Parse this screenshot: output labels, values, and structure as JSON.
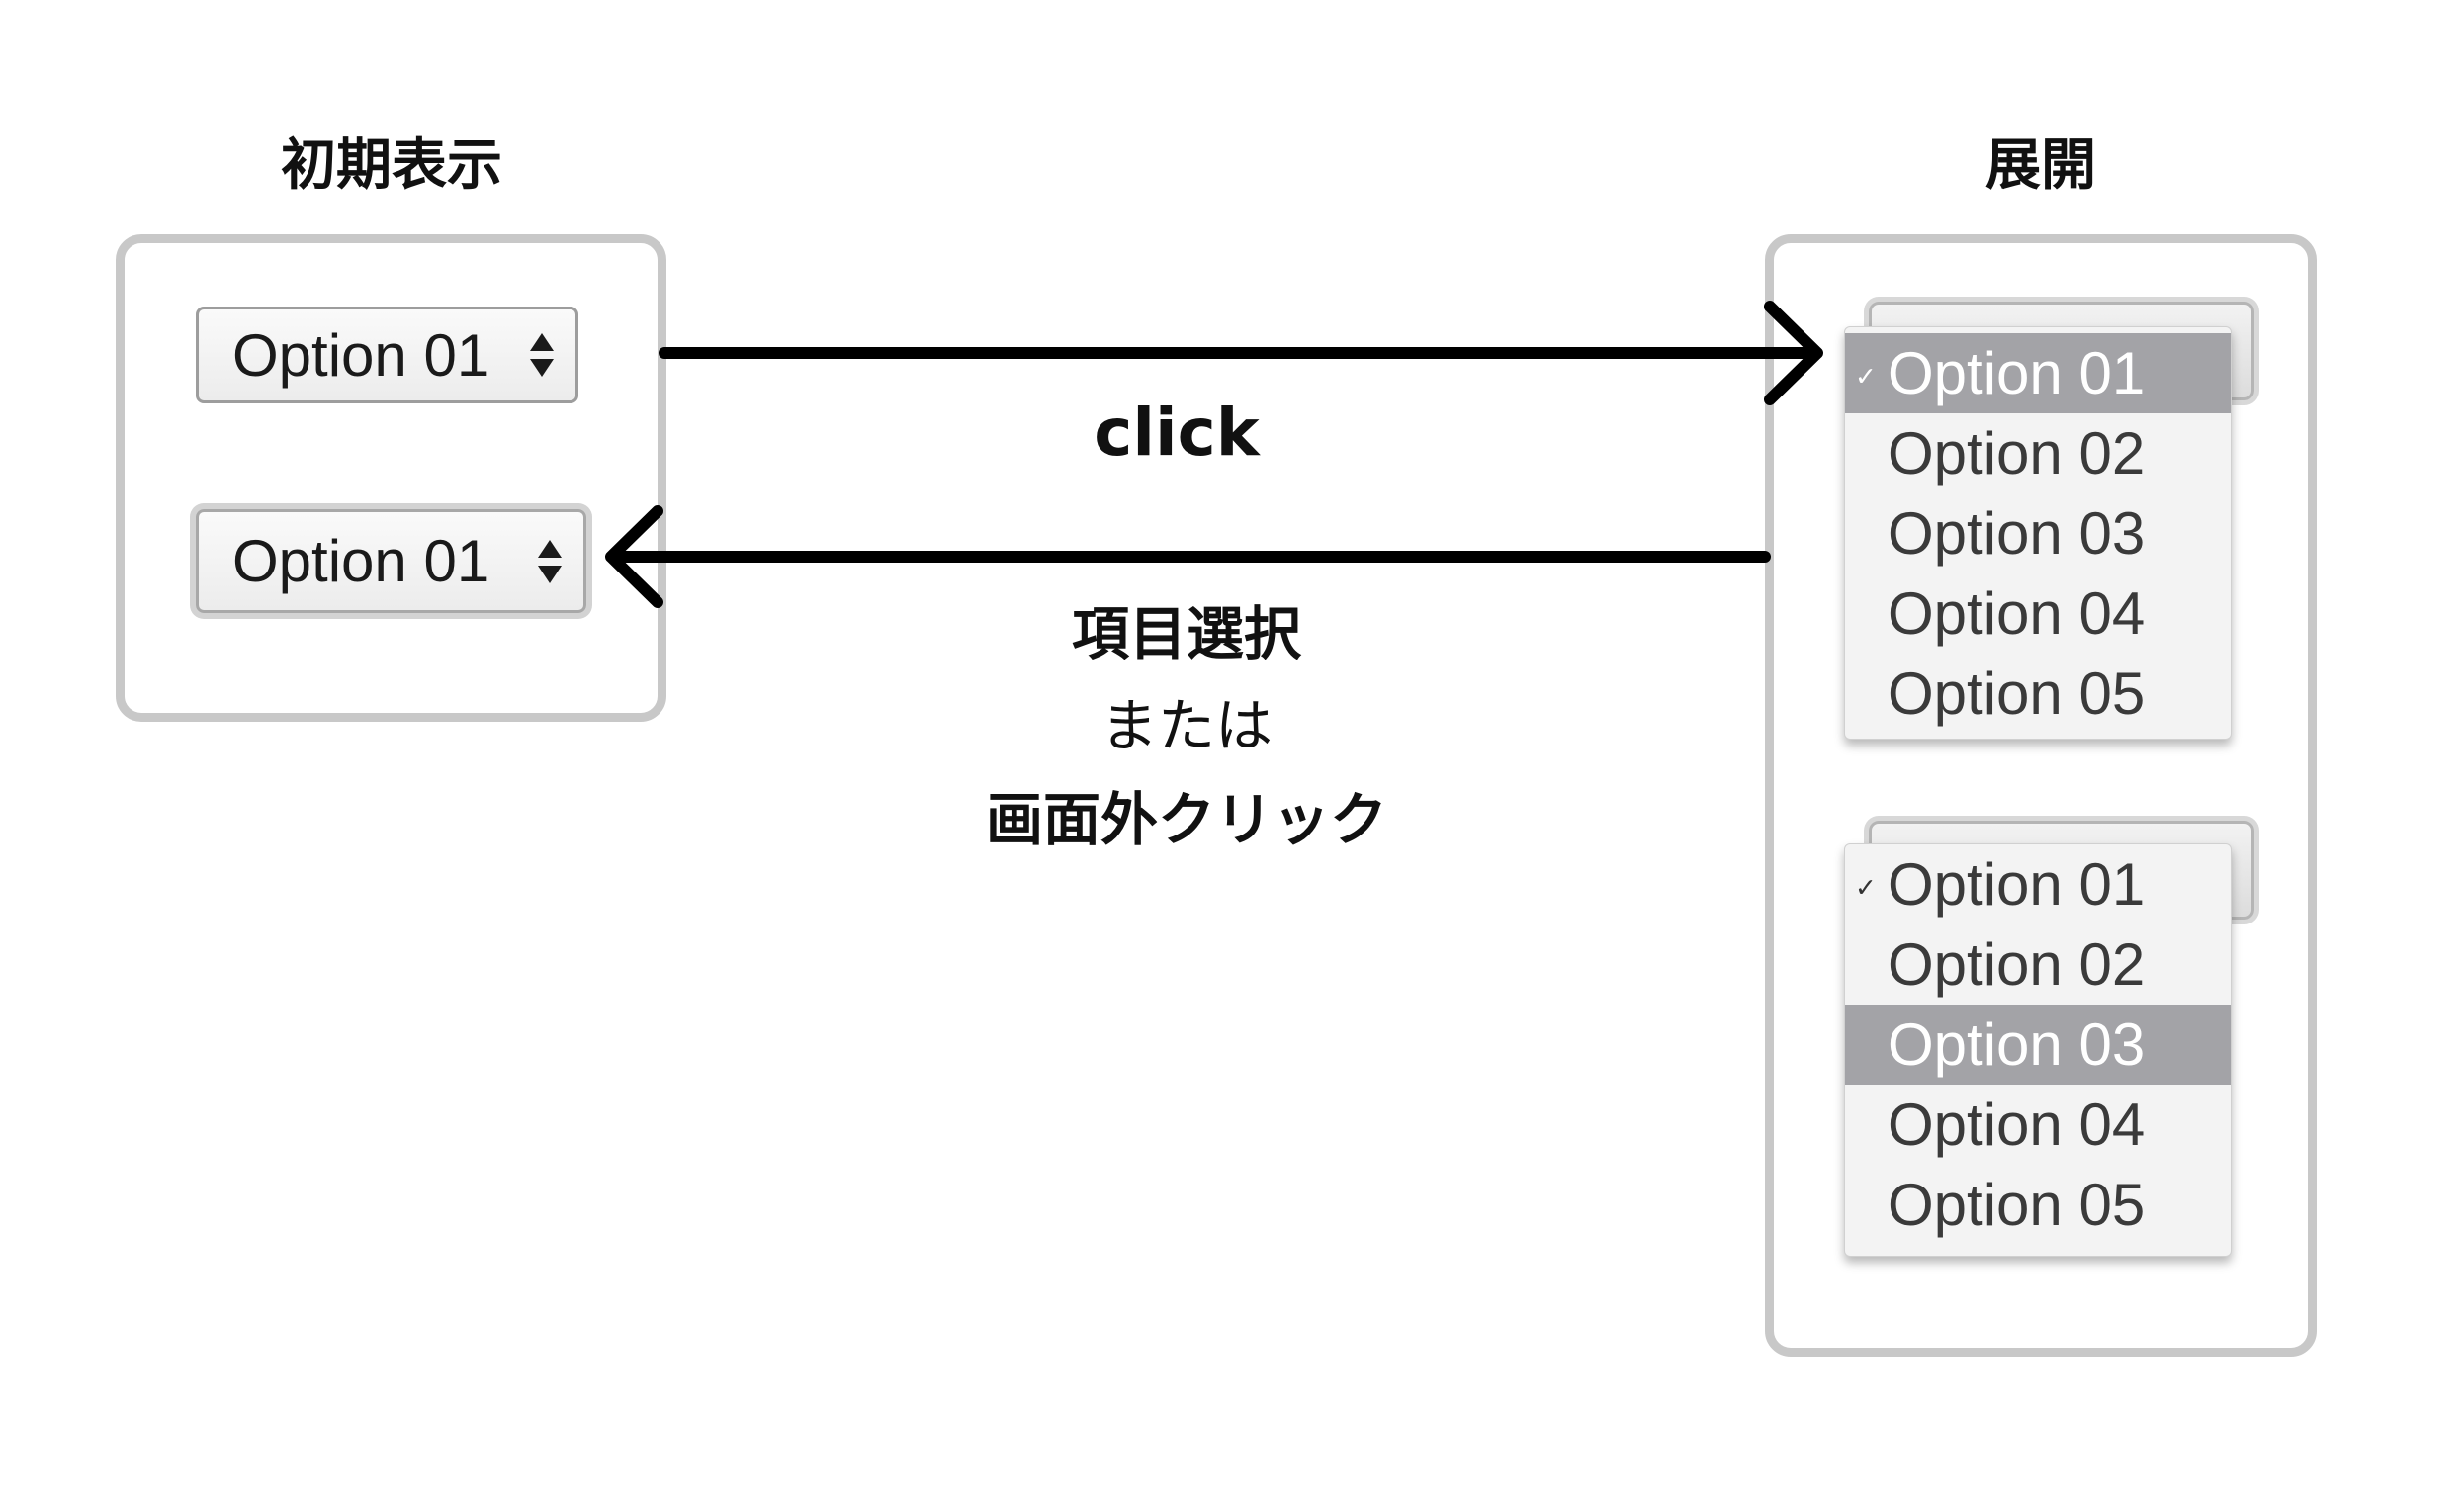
{
  "left": {
    "title": "初期表示",
    "select_top": {
      "value": "Option 01"
    },
    "select_bottom": {
      "value": "Option 01"
    }
  },
  "right": {
    "title": "展開",
    "menu_top": {
      "options": [
        "Option 01",
        "Option 02",
        "Option 03",
        "Option 04",
        "Option 05"
      ],
      "checked": "Option 01",
      "highlighted": "Option 01"
    },
    "menu_bottom": {
      "options": [
        "Option 01",
        "Option 02",
        "Option 03",
        "Option 04",
        "Option 05"
      ],
      "checked": "Option 01",
      "highlighted": "Option 03"
    }
  },
  "labels": {
    "click": "click",
    "select_item": "項目選択",
    "or": "または",
    "click_outside": "画面外クリック"
  },
  "check_mark": "✓",
  "colors": {
    "panel_border": "#c8c8c8",
    "highlight": "#a3a3a7",
    "arrow": "#000000"
  }
}
